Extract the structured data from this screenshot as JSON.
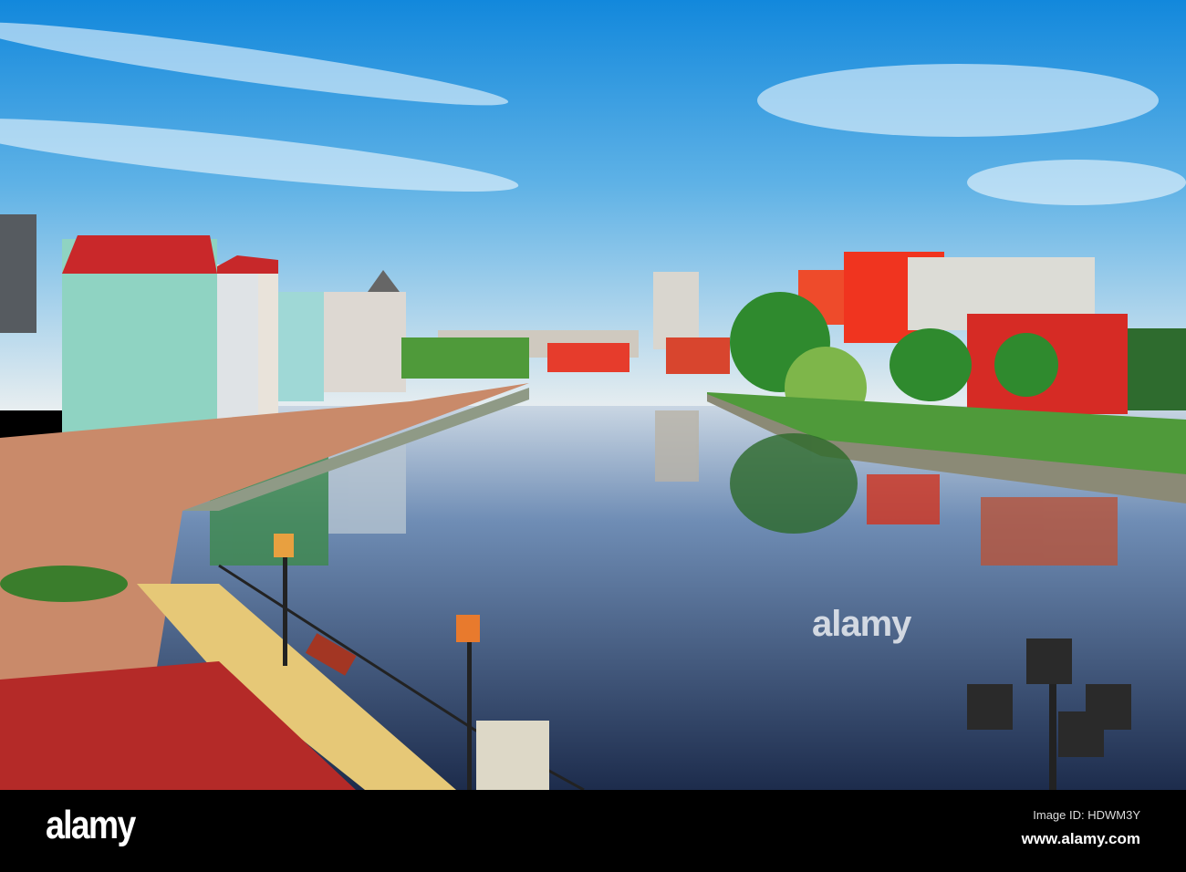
{
  "photo": {
    "subject": "river embankment with colorful buildings and reflections",
    "watermark": "alamy"
  },
  "footer": {
    "logo": "alamy",
    "image_id": "Image ID: HDWM3Y",
    "website": "www.alamy.com"
  },
  "colors": {
    "sky_top": "#1a8ee0",
    "sky_horizon": "#e6eef2",
    "water": "#2a3f63",
    "roof_red": "#b8262a",
    "building_mint": "#8fd3c2"
  }
}
